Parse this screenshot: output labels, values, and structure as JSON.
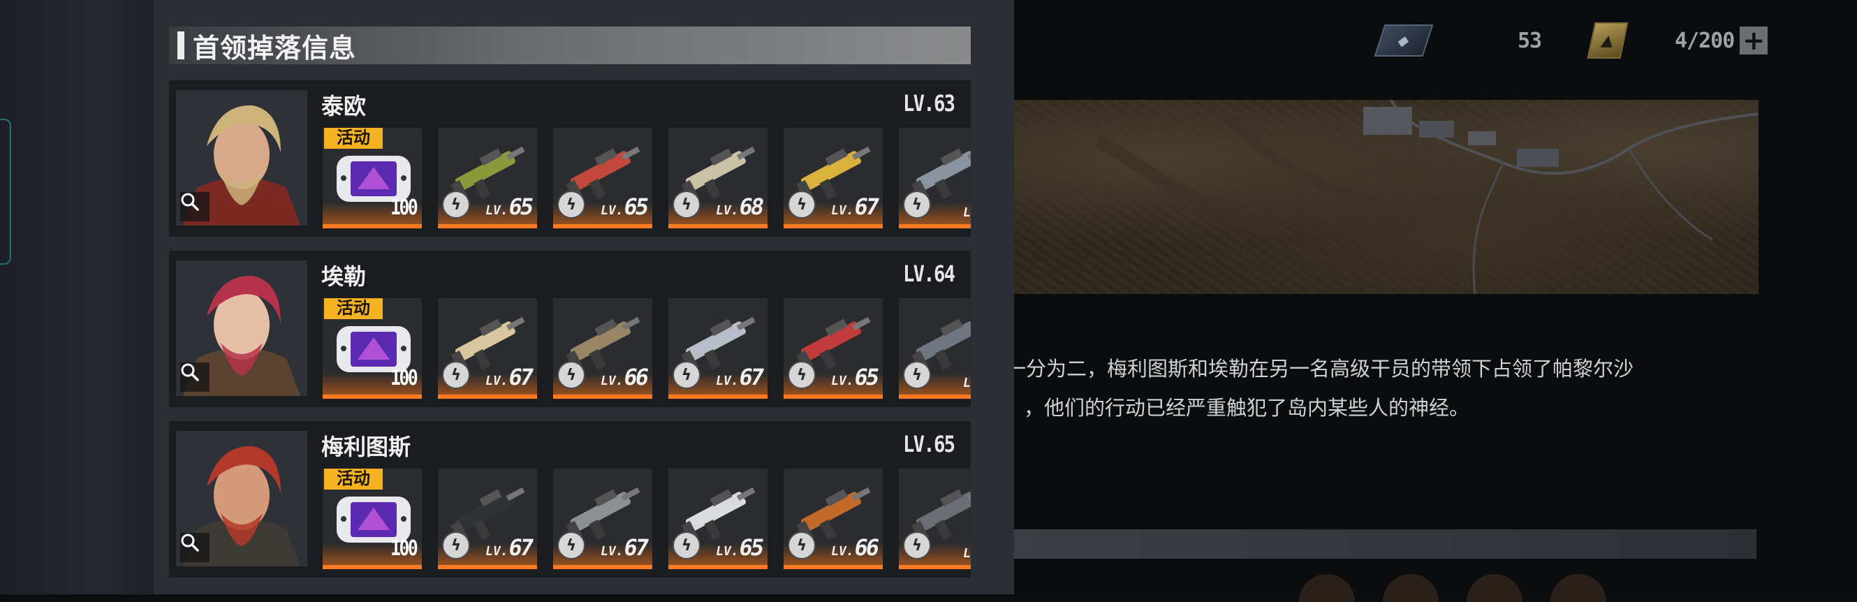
{
  "panel": {
    "title": "首领掉落信息",
    "bosses": [
      {
        "name": "泰欧",
        "level": "LV.63",
        "event_tag": "活动",
        "event_drop_count": "100",
        "weapon_levels": [
          "LV.",
          "65",
          "LV.",
          "65",
          "LV.",
          "68",
          "LV.",
          "67",
          "LV."
        ]
      },
      {
        "name": "埃勒",
        "level": "LV.64",
        "event_tag": "活动",
        "event_drop_count": "100",
        "weapon_levels": [
          "LV.",
          "67",
          "LV.",
          "66",
          "LV.",
          "67",
          "LV.",
          "65",
          "LV."
        ]
      },
      {
        "name": "梅利图斯",
        "level": "LV.65",
        "event_tag": "活动",
        "event_drop_count": "100",
        "weapon_levels": [
          "LV.",
          "67",
          "LV.",
          "67",
          "LV.",
          "65",
          "LV.",
          "66",
          "LV."
        ]
      }
    ]
  },
  "topbar": {
    "currency_1_value": "53",
    "currency_2_value": "4/200",
    "plus_label": "+"
  },
  "story": {
    "line1": "一分为二，梅利图斯和埃勒在另一名高级干员的带领下占领了帕黎尔沙",
    "line2": "，他们的行动已经严重触犯了岛内某些人的神经。"
  },
  "icons": {
    "search": "search-icon",
    "bolt": "lightning-icon",
    "console": "handheld-console-icon",
    "card_currency": "card-currency-icon",
    "fuel_currency": "fuel-can-icon"
  },
  "colors": {
    "event_tag": "#f5b323",
    "drop_glow": "#ff7a22"
  }
}
